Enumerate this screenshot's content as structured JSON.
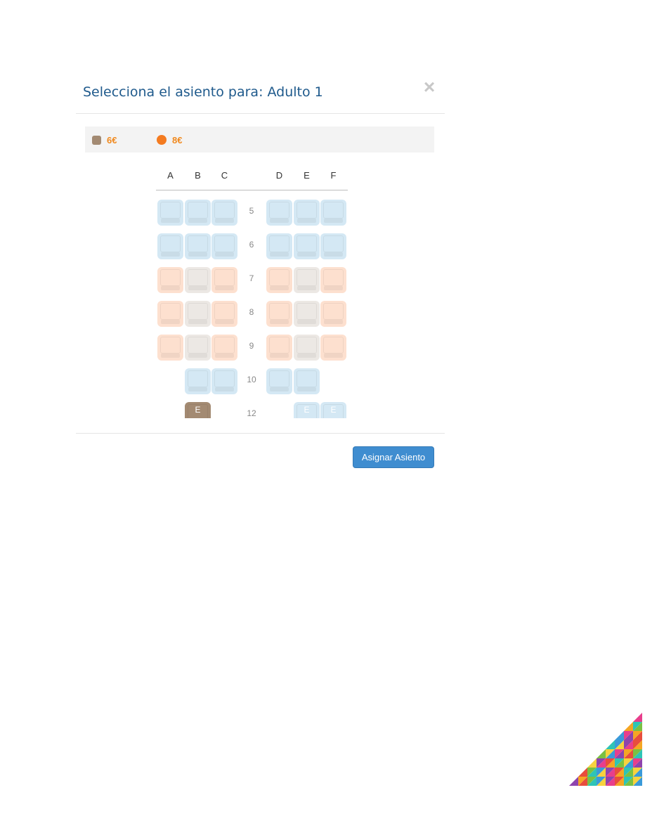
{
  "modal": {
    "title": "Selecciona el asiento para: Adulto 1",
    "close_label": "×"
  },
  "legend": [
    {
      "price": "6€",
      "color": "#a38a72",
      "shape": "square"
    },
    {
      "price": "8€",
      "color": "#f47b20",
      "shape": "circle"
    }
  ],
  "columns": [
    "A",
    "B",
    "C",
    "D",
    "E",
    "F"
  ],
  "rows": [
    {
      "number": "5",
      "seats": {
        "A": "blue",
        "B": "blue",
        "C": "blue",
        "D": "blue",
        "E": "blue",
        "F": "blue"
      }
    },
    {
      "number": "6",
      "seats": {
        "A": "blue",
        "B": "blue",
        "C": "blue",
        "D": "blue",
        "E": "blue",
        "F": "blue"
      }
    },
    {
      "number": "7",
      "seats": {
        "A": "orange",
        "B": "grey",
        "C": "orange",
        "D": "orange",
        "E": "grey",
        "F": "orange"
      }
    },
    {
      "number": "8",
      "seats": {
        "A": "orange",
        "B": "grey",
        "C": "orange",
        "D": "orange",
        "E": "grey",
        "F": "orange"
      }
    },
    {
      "number": "9",
      "seats": {
        "A": "orange",
        "B": "grey",
        "C": "orange",
        "D": "orange",
        "E": "grey",
        "F": "orange"
      }
    },
    {
      "number": "10",
      "seats": {
        "B": "blue",
        "C": "blue",
        "D": "blue",
        "E": "blue"
      }
    },
    {
      "number": "12",
      "seats": {
        "B": "brown",
        "E": "lightblue",
        "F": "lightblue"
      },
      "labels": {
        "B": "E",
        "E": "E",
        "F": "E"
      }
    }
  ],
  "footer": {
    "assign_label": "Asignar Asiento"
  },
  "colors": {
    "title": "#1f5a8c",
    "assign_button": "#3f8dd0",
    "price_text": "#f0891e"
  }
}
